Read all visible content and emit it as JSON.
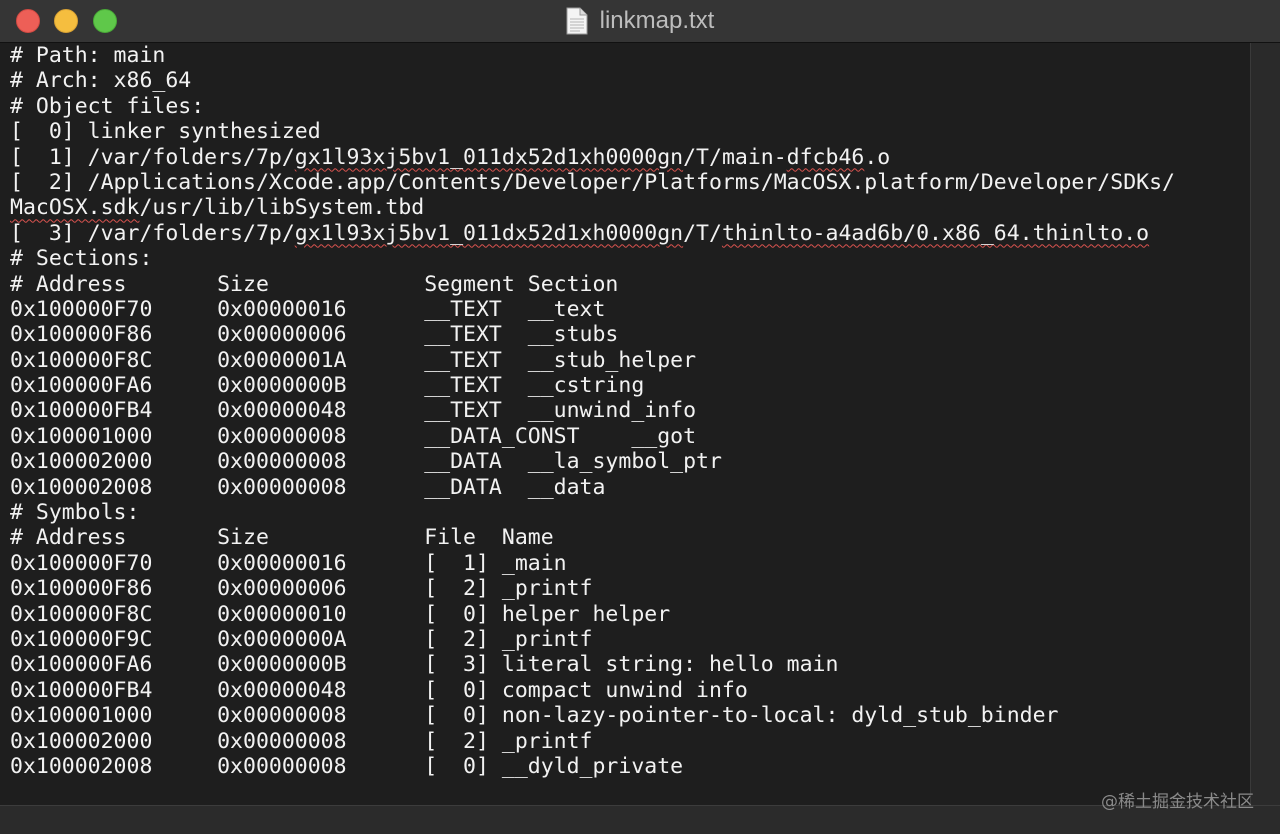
{
  "window": {
    "title": "linkmap.txt",
    "colors": {
      "red": "#ed5f57",
      "yellow": "#f5be3f",
      "green": "#5fc84a"
    },
    "icon": "document-icon"
  },
  "lines": [
    "# Path: main",
    "# Arch: x86_64",
    "# Object files:",
    "[  0] linker synthesized",
    "[  1] /var/folders/7p/gx1l93xj5bv1_011dx52d1xh0000gn/T/main-dfcb46.o",
    "[  2] /Applications/Xcode.app/Contents/Developer/Platforms/MacOSX.platform/Developer/SDKs/",
    "MacOSX.sdk/usr/lib/libSystem.tbd",
    "[  3] /var/folders/7p/gx1l93xj5bv1_011dx52d1xh0000gn/T/thinlto-a4ad6b/0.x86_64.thinlto.o",
    "# Sections:",
    "# Address       Size            Segment Section",
    "0x100000F70     0x00000016      __TEXT  __text",
    "0x100000F86     0x00000006      __TEXT  __stubs",
    "0x100000F8C     0x0000001A      __TEXT  __stub_helper",
    "0x100000FA6     0x0000000B      __TEXT  __cstring",
    "0x100000FB4     0x00000048      __TEXT  __unwind_info",
    "0x100001000     0x00000008      __DATA_CONST    __got",
    "0x100002000     0x00000008      __DATA  __la_symbol_ptr",
    "0x100002008     0x00000008      __DATA  __data",
    "# Symbols:",
    "# Address       Size            File  Name",
    "0x100000F70     0x00000016      [  1] _main",
    "0x100000F86     0x00000006      [  2] _printf",
    "0x100000F8C     0x00000010      [  0] helper helper",
    "0x100000F9C     0x0000000A      [  2] _printf",
    "0x100000FA6     0x0000000B      [  3] literal string: hello main",
    "0x100000FB4     0x00000048      [  0] compact unwind info",
    "0x100001000     0x00000008      [  0] non-lazy-pointer-to-local: dyld_stub_binder",
    "0x100002000     0x00000008      [  2] _printf",
    "0x100002008     0x00000008      [  0] __dyld_private"
  ],
  "watermark": "@稀土掘金技术社区"
}
